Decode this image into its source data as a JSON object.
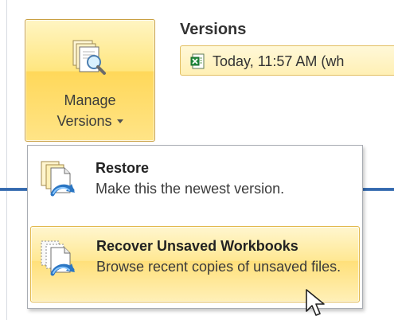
{
  "manage_versions": {
    "label_line1": "Manage",
    "label_line2": "Versions"
  },
  "versions": {
    "title": "Versions",
    "items": [
      {
        "text": "Today, 11:57 AM (wh"
      }
    ]
  },
  "dropdown": {
    "items": [
      {
        "title": "Restore",
        "description": "Make this the newest version."
      },
      {
        "title": "Recover Unsaved Workbooks",
        "description": "Browse recent copies of unsaved files."
      }
    ]
  },
  "icons": {
    "manage_versions": "manage-versions-icon",
    "version_file": "excel-file-icon",
    "restore": "restore-icon",
    "recover": "recover-unsaved-workbooks-icon",
    "cursor": "mouse-pointer-icon"
  },
  "colors": {
    "highlight_gold": "#ffe07a",
    "border_gold": "#e2b94f",
    "ribbon_blue": "#2f62a8",
    "text_dark": "#222222"
  }
}
